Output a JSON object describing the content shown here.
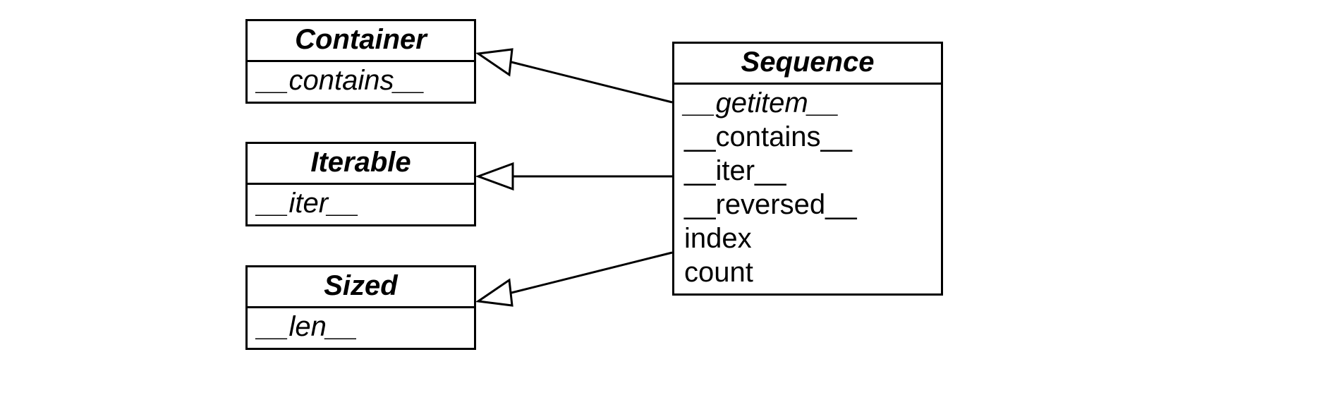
{
  "classes": {
    "container": {
      "name": "Container",
      "methods": [
        "__contains__"
      ],
      "abstract_methods": [
        "__contains__"
      ]
    },
    "iterable": {
      "name": "Iterable",
      "methods": [
        "__iter__"
      ],
      "abstract_methods": [
        "__iter__"
      ]
    },
    "sized": {
      "name": "Sized",
      "methods": [
        "__len__"
      ],
      "abstract_methods": [
        "__len__"
      ]
    },
    "sequence": {
      "name": "Sequence",
      "methods": [
        "__getitem__",
        "__contains__",
        "__iter__",
        "__reversed__",
        "index",
        "count"
      ],
      "abstract_methods": [
        "__getitem__"
      ]
    }
  },
  "relationships": [
    {
      "from": "sequence",
      "to": "container",
      "type": "inherits"
    },
    {
      "from": "sequence",
      "to": "iterable",
      "type": "inherits"
    },
    {
      "from": "sequence",
      "to": "sized",
      "type": "inherits"
    }
  ]
}
